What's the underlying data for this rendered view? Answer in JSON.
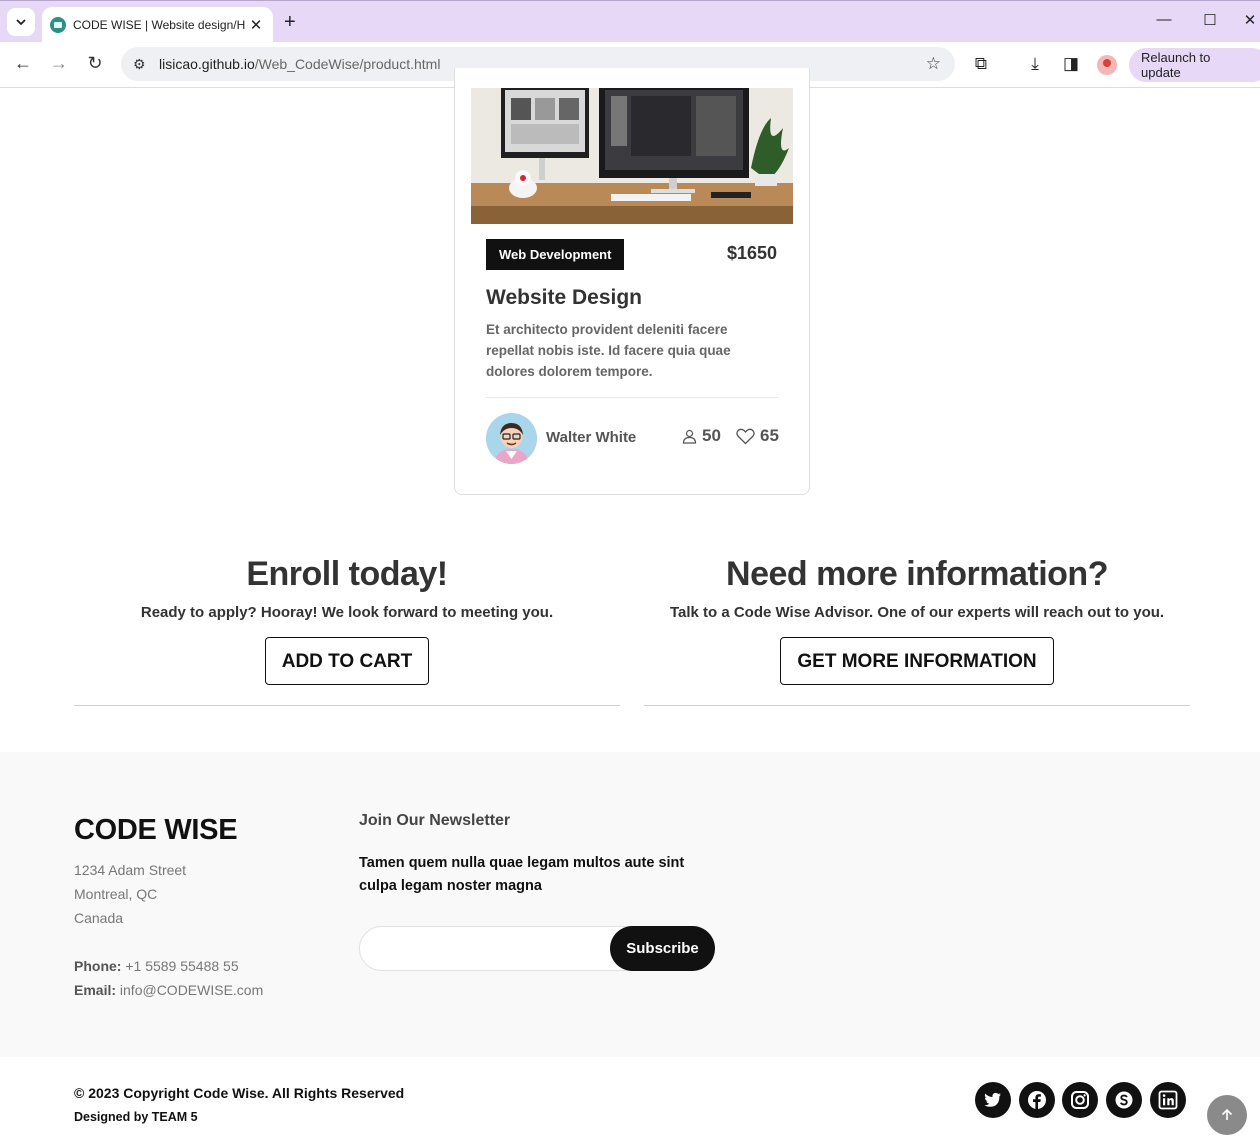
{
  "browser": {
    "tab_title": "CODE WISE | Website design/H",
    "url_host": "lisicao.github.io",
    "url_path": "/Web_CodeWise/product.html",
    "relaunch_label": "Relaunch to update",
    "icons": [
      "tab-dropdown-icon",
      "close-tab-icon",
      "new-tab-icon",
      "minimize-icon",
      "maximize-icon",
      "close-window-icon",
      "back-icon",
      "forward-icon",
      "reload-icon",
      "site-settings-icon",
      "bookmark-star-icon",
      "extensions-icon",
      "download-icon",
      "side-panel-icon",
      "profile-avatar-icon",
      "menu-icon"
    ]
  },
  "course": {
    "category": "Web Development",
    "price": "$1650",
    "title": "Website Design",
    "description": "Et architecto provident deleniti facere repellat nobis iste. Id facere quia quae dolores dolorem tempore.",
    "trainer": "Walter White",
    "students": "50",
    "likes": "65"
  },
  "cta": {
    "enroll_title": "Enroll today!",
    "enroll_text": "Ready to apply? Hooray! We look forward to meeting you.",
    "enroll_button": "ADD TO CART",
    "info_title": "Need more information?",
    "info_text": "Talk to a Code Wise Advisor. One of our experts will reach out to you.",
    "info_button": "GET MORE INFORMATION"
  },
  "footer": {
    "brand": "CODE WISE",
    "address_line1": "1234 Adam Street",
    "address_line2": "Montreal, QC",
    "address_line3": "Canada",
    "phone_label": "Phone:",
    "phone": "+1 5589 55488 55",
    "email_label": "Email:",
    "email": "info@CODEWISE.com",
    "newsletter_title": "Join Our Newsletter",
    "newsletter_text": "Tamen quem nulla quae legam multos aute sint culpa legam noster magna",
    "newsletter_input": "",
    "subscribe_label": "Subscribe",
    "copyright": "© 2023 Copyright Code Wise. All Rights Reserved",
    "designed_by": "Designed by TEAM 5",
    "social": [
      "twitter-icon",
      "facebook-icon",
      "instagram-icon",
      "skype-icon",
      "linkedin-icon"
    ]
  }
}
